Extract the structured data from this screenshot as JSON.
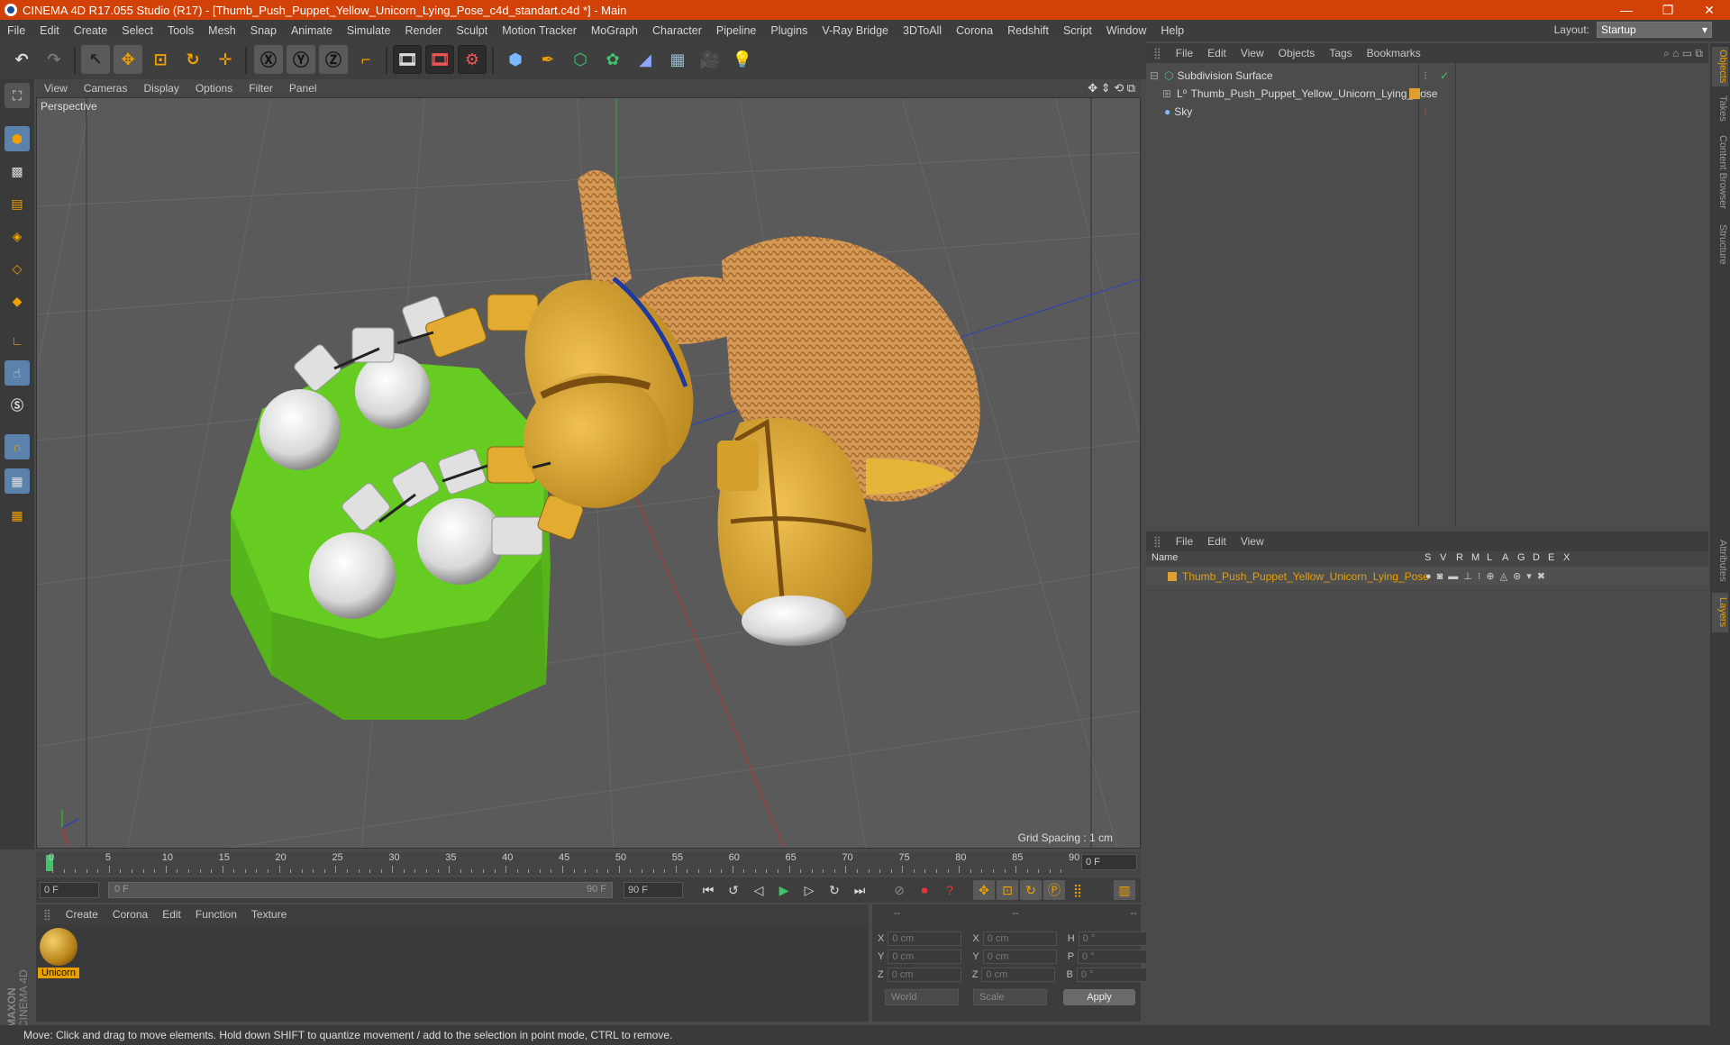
{
  "window": {
    "title": "CINEMA 4D R17.055 Studio (R17) - [Thumb_Push_Puppet_Yellow_Unicorn_Lying_Pose_c4d_standart.c4d *] - Main"
  },
  "menubar": {
    "items": [
      "File",
      "Edit",
      "Create",
      "Select",
      "Tools",
      "Mesh",
      "Snap",
      "Animate",
      "Simulate",
      "Render",
      "Sculpt",
      "Motion Tracker",
      "MoGraph",
      "Character",
      "Pipeline",
      "Plugins",
      "V-Ray Bridge",
      "3DToAll",
      "Corona",
      "Redshift",
      "Script",
      "Window",
      "Help"
    ],
    "layout_label": "Layout:",
    "layout_value": "Startup"
  },
  "viewport": {
    "menu": [
      "View",
      "Cameras",
      "Display",
      "Options",
      "Filter",
      "Panel"
    ],
    "label": "Perspective",
    "grid_spacing": "Grid Spacing : 1 cm"
  },
  "timeline": {
    "ticks": [
      "0",
      "5",
      "10",
      "15",
      "20",
      "25",
      "30",
      "35",
      "40",
      "45",
      "50",
      "55",
      "60",
      "65",
      "70",
      "75",
      "80",
      "85",
      "90"
    ],
    "current_frame": "0 F",
    "start_field": "0 F",
    "range_start": "0 F",
    "range_end": "90 F",
    "end_field": "90 F"
  },
  "material_manager": {
    "menu": [
      "Create",
      "Corona",
      "Edit",
      "Function",
      "Texture"
    ],
    "materials": [
      {
        "name": "Unicorn"
      }
    ]
  },
  "coordinates": {
    "headers": [
      "--",
      "--",
      "--"
    ],
    "rows": [
      {
        "a": "X",
        "b": "X",
        "c": "H",
        "v1": "0 cm",
        "v2": "0 cm",
        "v3": "0 °"
      },
      {
        "a": "Y",
        "b": "Y",
        "c": "P",
        "v1": "0 cm",
        "v2": "0 cm",
        "v3": "0 °"
      },
      {
        "a": "Z",
        "b": "Z",
        "c": "B",
        "v1": "0 cm",
        "v2": "0 cm",
        "v3": "0 °"
      }
    ],
    "world": "World",
    "scale": "Scale",
    "apply": "Apply"
  },
  "object_manager": {
    "menu": [
      "File",
      "Edit",
      "View",
      "Objects",
      "Tags",
      "Bookmarks"
    ],
    "objects": [
      {
        "name": "Subdivision Surface"
      },
      {
        "name": "Thumb_Push_Puppet_Yellow_Unicorn_Lying_Pose"
      },
      {
        "name": "Sky"
      }
    ]
  },
  "layer_manager": {
    "menu": [
      "File",
      "Edit",
      "View"
    ],
    "columns": [
      "Name",
      "S",
      "V",
      "R",
      "M",
      "L",
      "A",
      "G",
      "D",
      "E",
      "X"
    ],
    "layers": [
      {
        "name": "Thumb_Push_Puppet_Yellow_Unicorn_Lying_Pose"
      }
    ]
  },
  "side_tabs": [
    "Objects",
    "Takes",
    "Content Browser",
    "Structure",
    "Attributes",
    "Layers"
  ],
  "status": "Move: Click and drag to move elements. Hold down SHIFT to quantize movement / add to the selection in point mode, CTRL to remove.",
  "brand": {
    "line1": "MAXON",
    "line2": "CINEMA 4D"
  },
  "colors": {
    "titlebar": "#d24208",
    "accent": "#e8a000",
    "grass": "#62c81e",
    "puppet": "#dba433"
  }
}
